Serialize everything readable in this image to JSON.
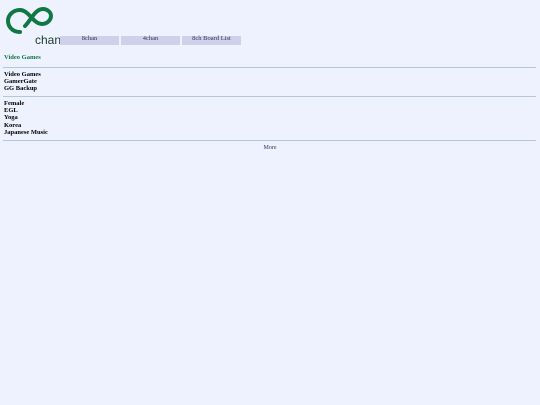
{
  "logo": {
    "text": "chan",
    "color": "#117743"
  },
  "tabs": [
    {
      "label": "8chan"
    },
    {
      "label": "4chan"
    },
    {
      "label": "8ch Board List"
    }
  ],
  "section_title": "Video Games",
  "group1": [
    {
      "label": "Video Games"
    },
    {
      "label": "GamerGate"
    },
    {
      "label": "GG Backup"
    }
  ],
  "group2": [
    {
      "label": "Female"
    },
    {
      "label": "EGL"
    },
    {
      "label": "Yoga"
    },
    {
      "label": "Korea"
    },
    {
      "label": "Japanese Music"
    }
  ],
  "more_label": "More",
  "colors": {
    "background": "#eef2ff",
    "tab": "#cdd1ea",
    "accent": "#117743",
    "rule": "#b7c5d9"
  }
}
